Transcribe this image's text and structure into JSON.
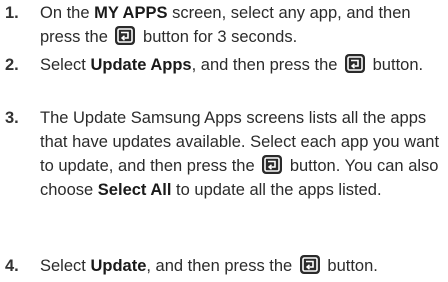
{
  "icons": {
    "enter_button": "enter-button-icon"
  },
  "steps": [
    {
      "number": "1.",
      "parts": [
        "On the ",
        "MY APPS",
        " screen, select any app, and then press the ",
        " button for 3 seconds."
      ]
    },
    {
      "number": "2.",
      "parts": [
        "Select ",
        "Update Apps",
        ", and then press the ",
        " button."
      ]
    },
    {
      "number": "3.",
      "parts": [
        "The Update Samsung Apps screens lists all the apps that have updates available. Select each app you want to update, and then press the ",
        " button. You can also choose ",
        "Select All",
        " to update all the apps listed."
      ]
    },
    {
      "number": "4.",
      "parts": [
        "Select ",
        "Update",
        ", and then press the ",
        " button."
      ]
    }
  ]
}
